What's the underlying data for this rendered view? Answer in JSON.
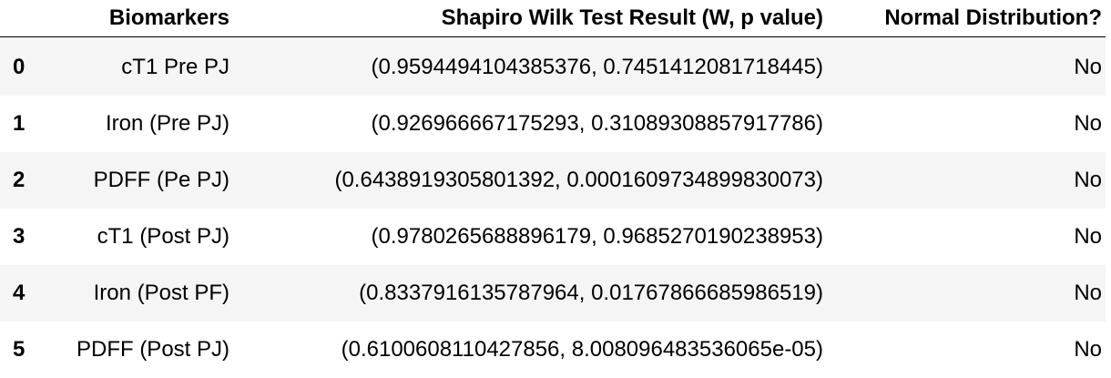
{
  "table": {
    "columns": [
      "",
      "Biomarkers",
      "Shapiro Wilk Test Result (W, p value)",
      "Normal Distribution?"
    ],
    "rows": [
      {
        "index": "0",
        "biomarker": "cT1 Pre PJ",
        "shapiro": "(0.9594494104385376, 0.7451412081718445)",
        "normal": "No"
      },
      {
        "index": "1",
        "biomarker": "Iron (Pre PJ)",
        "shapiro": "(0.926966667175293, 0.31089308857917786)",
        "normal": "No"
      },
      {
        "index": "2",
        "biomarker": "PDFF (Pe PJ)",
        "shapiro": "(0.6438919305801392, 0.0001609734899830073)",
        "normal": "No"
      },
      {
        "index": "3",
        "biomarker": "cT1 (Post PJ)",
        "shapiro": "(0.9780265688896179, 0.9685270190238953)",
        "normal": "No"
      },
      {
        "index": "4",
        "biomarker": "Iron (Post PF)",
        "shapiro": "(0.8337916135787964, 0.01767866685986519)",
        "normal": "No"
      },
      {
        "index": "5",
        "biomarker": "PDFF (Post PJ)",
        "shapiro": "(0.6100608110427856, 8.008096483536065e-05)",
        "normal": "No"
      }
    ]
  }
}
